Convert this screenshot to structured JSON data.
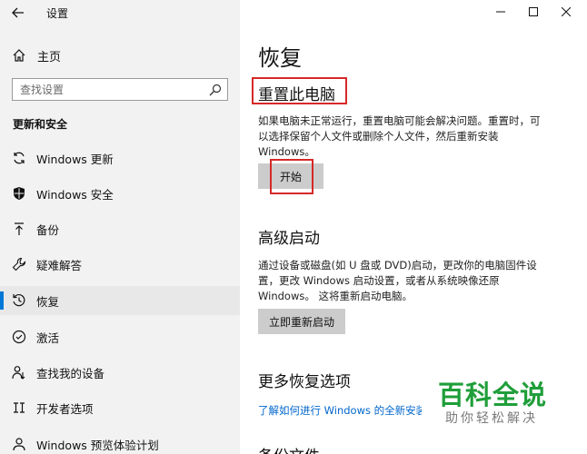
{
  "app": {
    "title": "设置"
  },
  "sidebar": {
    "home": "主页",
    "search_placeholder": "查找设置",
    "section": "更新和安全",
    "items": [
      {
        "label": "Windows 更新",
        "icon": "sync-icon"
      },
      {
        "label": "Windows 安全",
        "icon": "shield-icon"
      },
      {
        "label": "备份",
        "icon": "backup-arrow-icon"
      },
      {
        "label": "疑难解答",
        "icon": "wrench-icon"
      },
      {
        "label": "恢复",
        "icon": "recovery-icon",
        "active": true
      },
      {
        "label": "激活",
        "icon": "check-circle-icon"
      },
      {
        "label": "查找我的设备",
        "icon": "person-locate-icon"
      },
      {
        "label": "开发者选项",
        "icon": "developer-icon"
      },
      {
        "label": "Windows 预览体验计划",
        "icon": "insider-icon"
      }
    ]
  },
  "main": {
    "title": "恢复",
    "reset": {
      "heading": "重置此电脑",
      "description": "如果电脑未正常运行，重置电脑可能会解决问题。重置时，可以选择保留个人文件或删除个人文件，然后重新安装 Windows。",
      "button": "开始"
    },
    "advanced": {
      "heading": "高级启动",
      "description": "通过设备或磁盘(如 U 盘或 DVD)启动，更改你的电脑固件设置，更改 Windows 启动设置，或者从系统映像还原 Windows。 这将重新启动电脑。",
      "button": "立即重新启动"
    },
    "more": {
      "heading": "更多恢复选项",
      "link": "了解如何进行 Windows 的全新安装"
    },
    "backup_heading": "备份文件"
  },
  "watermark": {
    "title": "百科全说",
    "subtitle": "助你轻松解决"
  },
  "colors": {
    "accent": "#0078d7",
    "highlight_box": "#d62929",
    "watermark": "#1f9e3a"
  }
}
